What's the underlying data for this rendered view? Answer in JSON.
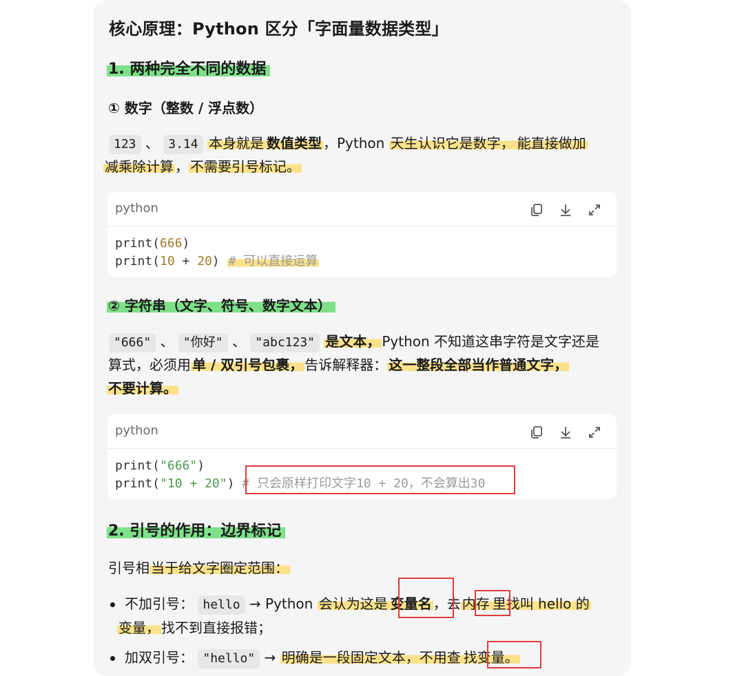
{
  "title": "核心原理：Python 区分「字面量数据类型」",
  "section1": {
    "heading": "1. 两种完全不同的数据",
    "sub1": "① 数字（整数 / 浮点数）",
    "chip_a": "123",
    "sep": "、",
    "chip_b": "3.14",
    "p1_a": "本身就是",
    "p1_b": "数值类型",
    "p1_c": "，Python ",
    "p1_d": "天生认识它是数字，",
    "p1_e": "能直接做加",
    "p1_f": "减乘除计算",
    "p1_g": "，",
    "p1_h": "不需要引号标记。",
    "code1": {
      "lang": "python",
      "l1_fn": "print(",
      "l1_num": "666",
      "l1_end": ")",
      "l2_fn": "print(",
      "l2_a": "10",
      "l2_op": " + ",
      "l2_b": "20",
      "l2_end": ")",
      "l2_cmt": "# 可以直接运算"
    },
    "sub2": "② 字符串（文字、符号、数字文本）",
    "chip_c": "\"666\"",
    "chip_d": "\"你好\"",
    "chip_e": "\"abc123\"",
    "p2_a": "是文本，",
    "p2_b": "Python 不知道这串字符是文字还是",
    "p2_c": "算式，必须用",
    "p2_d": "单 / 双引号包裹，",
    "p2_e": "告诉解释器：",
    "p2_f": "这一整段全部当作普通文字，",
    "p2_g": "不要计算。",
    "code2": {
      "lang": "python",
      "l1_fn": "print(",
      "l1_str": "\"666\"",
      "l1_end": ")",
      "l2_fn": "print(",
      "l2_str": "\"10 + 20\"",
      "l2_end": ")",
      "l2_cmt": "# 只会原样打印文字10 + 20，不会算出30"
    }
  },
  "section2": {
    "heading": "2. 引号的作用：边界标记",
    "intro_a": "引号相",
    "intro_b": "当于给文字圈定范围：",
    "b1_a": "不加引号：",
    "b1_chip": "hello",
    "b1_b": " → Python ",
    "b1_c": "会认为这是",
    "b1_d": "变量名",
    "b1_e": "，去",
    "b1_f": "内存",
    "b1_g": "里找叫 hello 的",
    "b1_h": "变量，",
    "b1_i": "找不到直接报错；",
    "b2_a": "加双引号：",
    "b2_chip": "\"hello\"",
    "b2_b": " → ",
    "b2_c": "明确是一段固定文本，不用查",
    "b2_d": "找变量。"
  },
  "icons": [
    "copy-icon",
    "download-icon",
    "expand-icon"
  ],
  "colors": {
    "highlight_yellow": "#fbe28a",
    "highlight_green": "#7fe08a",
    "annotation_red": "#e03b3b"
  }
}
